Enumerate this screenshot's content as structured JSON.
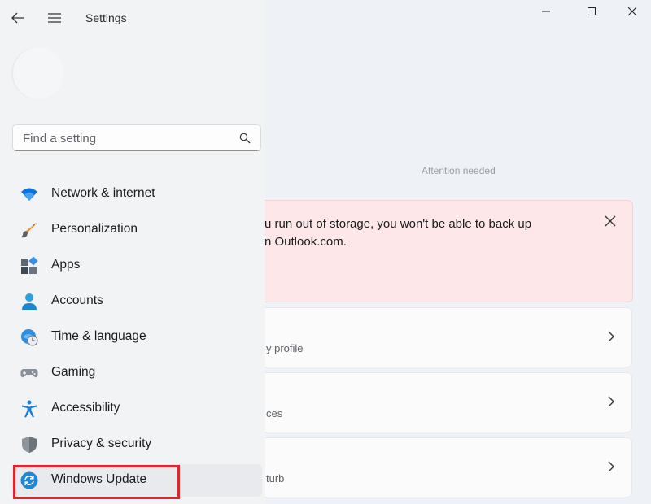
{
  "window": {
    "title": "Settings",
    "controls": [
      "minimize-icon",
      "maximize-icon",
      "close-icon"
    ]
  },
  "search": {
    "placeholder": "Find a setting",
    "value": ""
  },
  "sidebar": {
    "items": [
      {
        "label": "Network & internet",
        "icon": "wifi-icon"
      },
      {
        "label": "Personalization",
        "icon": "brush-icon"
      },
      {
        "label": "Apps",
        "icon": "apps-icon"
      },
      {
        "label": "Accounts",
        "icon": "person-icon"
      },
      {
        "label": "Time & language",
        "icon": "globe-clock-icon"
      },
      {
        "label": "Gaming",
        "icon": "gamepad-icon"
      },
      {
        "label": "Accessibility",
        "icon": "accessibility-icon"
      },
      {
        "label": "Privacy & security",
        "icon": "shield-icon"
      },
      {
        "label": "Windows Update",
        "icon": "sync-icon",
        "selected": true
      }
    ]
  },
  "main": {
    "faint_text": "Attention needed",
    "banner": {
      "line1": "u run out of storage, you won't be able to back up",
      "line2": "n Outlook.com."
    },
    "cards": [
      {
        "subtitle": "y profile"
      },
      {
        "subtitle": "ces"
      },
      {
        "subtitle": "turb"
      }
    ]
  },
  "colors": {
    "accent": "#0067c0",
    "banner_bg": "#fde7e9",
    "highlight": "#e0262d"
  }
}
